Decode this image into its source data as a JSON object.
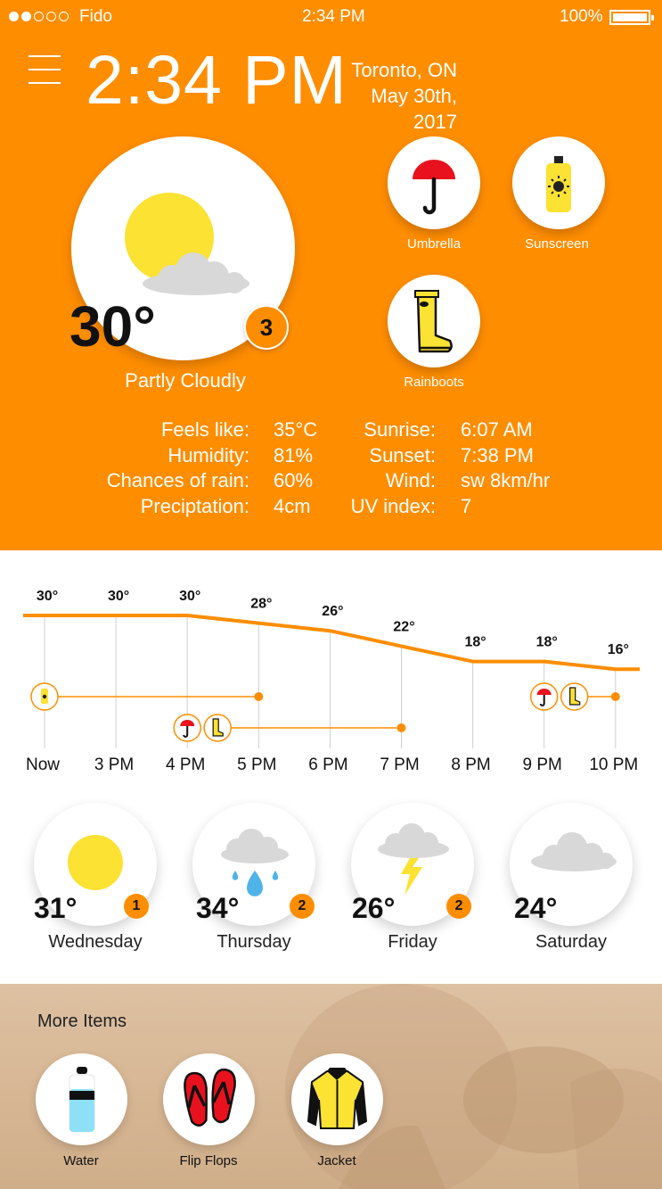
{
  "status_bar": {
    "carrier": "Fido",
    "time": "2:34 PM",
    "battery": "100%",
    "signal_strength": 2,
    "signal_total": 5
  },
  "header": {
    "time": "2:34 PM",
    "city": "Toronto, ON",
    "date": "May 30th, 2017"
  },
  "current": {
    "temperature": "30°",
    "condition": "Partly Cloudly",
    "badge": "3"
  },
  "recommended_items": [
    {
      "label": "Umbrella",
      "icon": "umbrella-icon"
    },
    {
      "label": "Sunscreen",
      "icon": "sunscreen-icon"
    },
    {
      "label": "Rainboots",
      "icon": "rainboots-icon"
    }
  ],
  "stats_left": [
    {
      "label": "Feels like:",
      "value": "35°C"
    },
    {
      "label": "Humidity:",
      "value": "81%"
    },
    {
      "label": "Chances of rain:",
      "value": "60%"
    },
    {
      "label": "Preciptation:",
      "value": "4cm"
    }
  ],
  "stats_right": [
    {
      "label": "Sunrise:",
      "value": "6:07 AM"
    },
    {
      "label": "Sunset:",
      "value": "7:38 PM"
    },
    {
      "label": "Wind:",
      "value": "sw 8km/hr"
    },
    {
      "label": "UV index:",
      "value": "7"
    }
  ],
  "chart_data": {
    "type": "line",
    "categories": [
      "Now",
      "3 PM",
      "4 PM",
      "5 PM",
      "6 PM",
      "7 PM",
      "8 PM",
      "9 PM",
      "10 PM"
    ],
    "values": [
      30,
      30,
      30,
      28,
      26,
      22,
      18,
      18,
      16
    ],
    "value_labels": [
      "30°",
      "30°",
      "30°",
      "28°",
      "26°",
      "22°",
      "18°",
      "18°",
      "16°"
    ],
    "item_ranges": [
      {
        "item": "sunscreen-icon",
        "from": "Now",
        "to": "5 PM"
      },
      {
        "items": [
          "umbrella-icon",
          "rainboots-icon"
        ],
        "from": "4 PM",
        "to": "7 PM"
      },
      {
        "items": [
          "umbrella-icon",
          "rainboots-icon"
        ],
        "from": "9 PM",
        "to": "10 PM"
      }
    ],
    "line_color": "#ff8d00"
  },
  "daily": [
    {
      "day": "Wednesday",
      "temp": "31°",
      "badge": "1",
      "icon": "sun-icon"
    },
    {
      "day": "Thursday",
      "temp": "34°",
      "badge": "2",
      "icon": "rain-cloud-icon"
    },
    {
      "day": "Friday",
      "temp": "26°",
      "badge": "2",
      "icon": "storm-cloud-icon"
    },
    {
      "day": "Saturday",
      "temp": "24°",
      "badge": null,
      "icon": "cloud-icon"
    }
  ],
  "more_items": {
    "title": "More Items",
    "items": [
      {
        "label": "Water",
        "icon": "water-bottle-icon"
      },
      {
        "label": "Flip Flops",
        "icon": "flip-flops-icon"
      },
      {
        "label": "Jacket",
        "icon": "jacket-icon"
      }
    ]
  },
  "colors": {
    "accent": "#ff8d00",
    "sun": "#fbe233",
    "umbrella_red": "#e8121e",
    "cloud": "#d8d8d8",
    "rain_blue": "#4fb3e8"
  }
}
